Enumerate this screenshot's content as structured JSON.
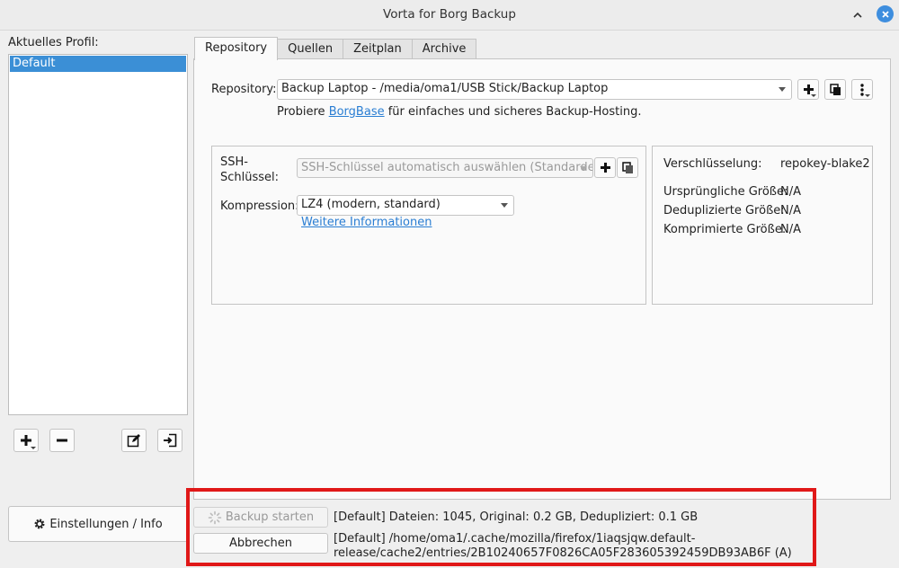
{
  "window": {
    "title": "Vorta for Borg Backup"
  },
  "sidebar": {
    "profile_label": "Aktuelles Profil:",
    "profiles": [
      "Default"
    ],
    "settings_button": "Einstellungen / Info"
  },
  "tabs": [
    {
      "label": "Repository",
      "active": true
    },
    {
      "label": "Quellen"
    },
    {
      "label": "Zeitplan"
    },
    {
      "label": "Archive"
    }
  ],
  "repository": {
    "label": "Repository:",
    "selected": "Backup Laptop - /media/oma1/USB Stick/Backup Laptop",
    "hint_prefix": "Probiere ",
    "hint_link": "BorgBase",
    "hint_suffix": " für einfaches und sicheres Backup-Hosting."
  },
  "ssh": {
    "label": "SSH-Schlüssel:",
    "placeholder": "SSH-Schlüssel automatisch auswählen (Standardeinst"
  },
  "compression": {
    "label": "Kompression:",
    "selected": "LZ4 (modern, standard)",
    "more_info": "Weitere Informationen"
  },
  "repo_info": {
    "encryption_label": "Verschlüsselung:",
    "encryption_value": "repokey-blake2",
    "original_size_label": "Ursprüngliche Größe:",
    "original_size_value": "N/A",
    "dedup_size_label": "Deduplizierte Größe:",
    "dedup_size_value": "N/A",
    "compressed_size_label": "Komprimierte Größe:",
    "compressed_size_value": "N/A"
  },
  "actions": {
    "start_label": "Backup starten",
    "cancel_label": "Abbrechen"
  },
  "status": {
    "line1": "[Default] Dateien: 1045, Original: 0.2 GB, Dedupliziert: 0.1 GB",
    "line2": "[Default] /home/oma1/.cache/mozilla/firefox/1iaqsjqw.default-release/cache2/entries/2B10240657F0826CA05F283605392459DB93AB6F (A)"
  },
  "colors": {
    "accent": "#3b8fd6",
    "link": "#2a7ed3",
    "highlight": "#e01818"
  }
}
